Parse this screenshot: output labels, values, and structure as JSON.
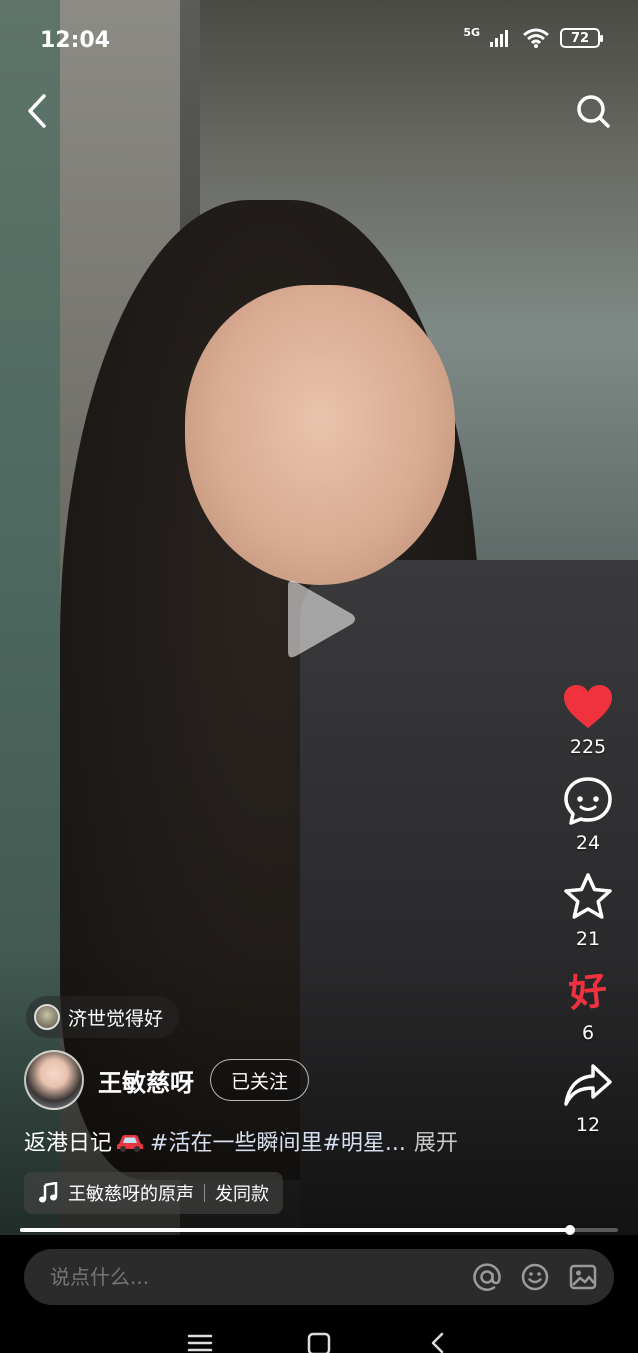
{
  "status_bar": {
    "time": "12:04",
    "network": "5G",
    "battery": "72"
  },
  "video": {
    "state": "paused",
    "progress": 0.92
  },
  "top_bar": {
    "back_icon": "back-arrow-icon",
    "search_icon": "search-icon"
  },
  "actions": {
    "like": {
      "count": "225",
      "icon": "heart-icon",
      "color": "#f0323f"
    },
    "comment": {
      "count": "24",
      "icon": "comment-icon"
    },
    "favorite": {
      "count": "21",
      "icon": "star-icon"
    },
    "good": {
      "label": "好",
      "count": "6"
    },
    "share": {
      "count": "12",
      "icon": "share-icon"
    }
  },
  "friend_tag": {
    "text": "济世觉得好"
  },
  "author": {
    "name": "王敏慈呀",
    "follow_label": "已关注"
  },
  "caption": {
    "text": "返港日记",
    "hashtags": "#活在一些瞬间里#明星...",
    "expand": "展开"
  },
  "music": {
    "title": "王敏慈呀的原声",
    "action": "发同款"
  },
  "comment_box": {
    "placeholder": "说点什么..."
  }
}
